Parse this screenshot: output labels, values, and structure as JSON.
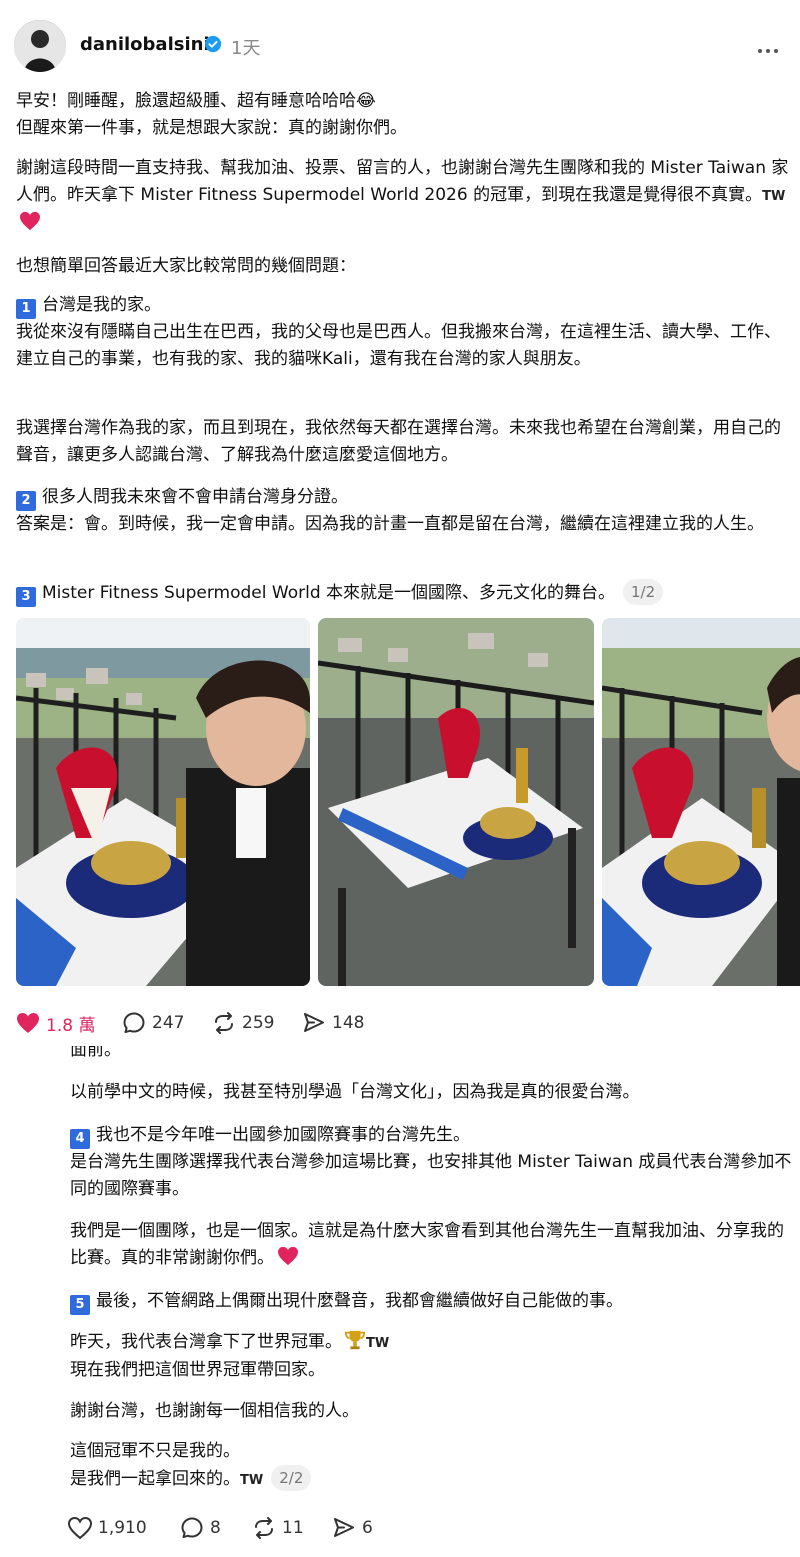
{
  "post": {
    "username": "danilobalsini",
    "time": "1天",
    "intro_line1": "早安！剛睡醒，臉還超級腫、超有睡意哈哈哈😂",
    "intro_line2": "但醒來第一件事，就是想跟大家說：真的謝謝你們。",
    "thanks": "謝謝這段時間一直支持我、幫我加油、投票、留言的人，也謝謝台灣先生團隊和我的 Mister Taiwan 家人們。昨天拿下 Mister Fitness Supermodel World 2026 的冠軍，到現在我還是覺得很不真實。",
    "tw": "TW",
    "faq_intro": "也想簡單回答最近大家比較常問的幾個問題：",
    "q1_num": "1",
    "q1_title": "台灣是我的家。",
    "q1_body": "我從來沒有隱瞞自己出生在巴西，我的父母也是巴西人。但我搬來台灣，在這裡生活、讀大學、工作、建立自己的事業，也有我的家、我的貓咪Kali，還有我在台灣的家人與朋友。",
    "q1_body2": "我選擇台灣作為我的家，而且到現在，我依然每天都在選擇台灣。未來我也希望在台灣創業，用自己的聲音，讓更多人認識台灣、了解我為什麼這麼愛這個地方。",
    "q2_num": "2",
    "q2_title": "很多人問我未來會不會申請台灣身分證。",
    "q2_body": "答案是：會。到時候，我一定會申請。因為我的計畫一直都是留在台灣，繼續在這裡建立我的人生。",
    "q3_num": "3",
    "q3_title": "Mister Fitness Supermodel World 本來就是一個國際、多元文化的舞台。",
    "page1": "1/2"
  },
  "actions1": {
    "likes": "1.8 萬",
    "comments": "247",
    "reposts": "259",
    "shares": "148"
  },
  "reply": {
    "cut_text": "面前。",
    "chinese_study": "以前學中文的時候，我甚至特別學過「台灣文化」，因為我是真的很愛台灣。",
    "q4_num": "4",
    "q4_title": "我也不是今年唯一出國參加國際賽事的台灣先生。",
    "q4_body": "是台灣先生團隊選擇我代表台灣參加這場比賽，也安排其他 Mister Taiwan 成員代表台灣參加不同的國際賽事。",
    "team": "我們是一個團隊，也是一個家。這就是為什麼大家會看到其他台灣先生一直幫我加油、分享我的比賽。真的非常謝謝你們。",
    "q5_num": "5",
    "q5_title": "最後，不管網路上偶爾出現什麼聲音，我都會繼續做好自己能做的事。",
    "yesterday": "昨天，我代表台灣拿下了世界冠軍。",
    "bring_home": "現在我們把這個世界冠軍帶回家。",
    "thanks_tw": "謝謝台灣，也謝謝每一個相信我的人。",
    "not_mine": "這個冠軍不只是我的。",
    "together": "是我們一起拿回來的。",
    "page2": "2/2"
  },
  "actions2": {
    "likes": "1,910",
    "comments": "8",
    "reposts": "11",
    "shares": "6"
  },
  "colors": {
    "accent": "#2f6bdc",
    "like": "#e0245e",
    "muted": "#8a8a8a"
  },
  "icons": [
    "verified-icon",
    "more-icon",
    "heart-icon",
    "comment-icon",
    "repost-icon",
    "share-icon",
    "trophy-icon"
  ]
}
